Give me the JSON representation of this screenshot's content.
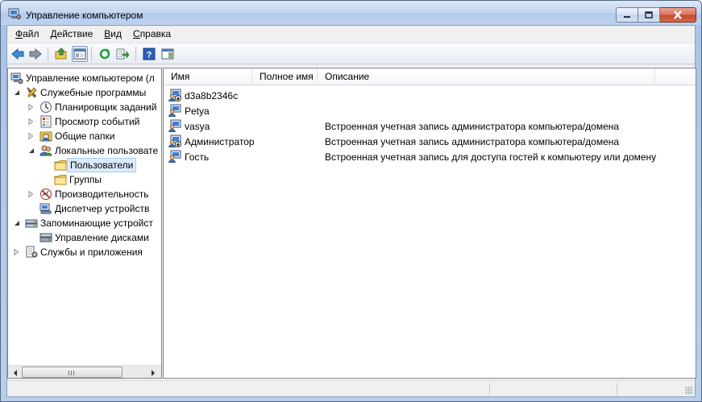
{
  "window": {
    "title": "Управление компьютером",
    "colors": {
      "title_bg": "#c3d6ef",
      "close_button": "#c44b2c",
      "selection": "#dcebfc"
    }
  },
  "menu": [
    {
      "label": "Файл"
    },
    {
      "label": "Действие"
    },
    {
      "label": "Вид"
    },
    {
      "label": "Справка"
    }
  ],
  "toolbar": {
    "buttons": [
      "back-arrow-icon",
      "forward-arrow-icon",
      "up-folder-icon",
      "show-tree-icon",
      "refresh-icon",
      "export-list-icon",
      "help-icon",
      "action-pane-icon"
    ]
  },
  "tree": {
    "items": [
      {
        "label": "Управление компьютером (л",
        "icon": "computer-management-icon",
        "expander": "none"
      },
      {
        "label": "Служебные программы",
        "icon": "tools-icon",
        "expander": "expanded"
      },
      {
        "label": "Планировщик заданий",
        "icon": "task-scheduler-icon",
        "expander": "collapsed"
      },
      {
        "label": "Просмотр событий",
        "icon": "event-viewer-icon",
        "expander": "collapsed"
      },
      {
        "label": "Общие папки",
        "icon": "shared-folders-icon",
        "expander": "collapsed"
      },
      {
        "label": "Локальные пользовате",
        "icon": "local-users-icon",
        "expander": "expanded"
      },
      {
        "label": "Пользователи",
        "icon": "folder-icon",
        "expander": "none",
        "selected": true
      },
      {
        "label": "Группы",
        "icon": "folder-icon",
        "expander": "none"
      },
      {
        "label": "Производительность",
        "icon": "performance-icon",
        "expander": "collapsed"
      },
      {
        "label": "Диспетчер устройств",
        "icon": "device-manager-icon",
        "expander": "none"
      },
      {
        "label": "Запоминающие устройст",
        "icon": "storage-icon",
        "expander": "expanded"
      },
      {
        "label": "Управление дисками",
        "icon": "disk-management-icon",
        "expander": "none"
      },
      {
        "label": "Службы и приложения",
        "icon": "services-icon",
        "expander": "collapsed"
      }
    ]
  },
  "list": {
    "columns": [
      {
        "label": "Имя"
      },
      {
        "label": "Полное имя"
      },
      {
        "label": "Описание"
      }
    ],
    "rows": [
      {
        "name": "d3a8b2346c",
        "full_name": "",
        "description": "",
        "disabled": true
      },
      {
        "name": "Petya",
        "full_name": "",
        "description": "",
        "disabled": false
      },
      {
        "name": "vasya",
        "full_name": "",
        "description": "Встроенная учетная запись администратора компьютера/домена",
        "disabled": false
      },
      {
        "name": "Администратор",
        "full_name": "",
        "description": "Встроенная учетная запись администратора компьютера/домена",
        "disabled": true
      },
      {
        "name": "Гость",
        "full_name": "",
        "description": "Встроенная учетная запись для доступа гостей к компьютеру или домену",
        "disabled": false
      }
    ]
  }
}
